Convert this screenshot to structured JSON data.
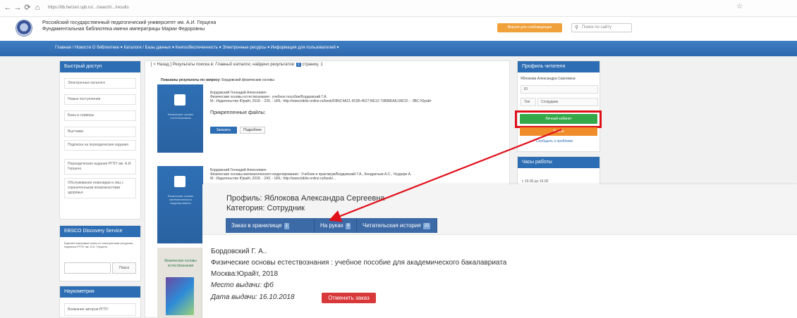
{
  "browser": {
    "url": "https://lib.herzen.spb.ru/.../search/.../results",
    "back_icon": "←",
    "forward_icon": "→",
    "reload_icon": "⟳",
    "home_icon": "⌂",
    "star_icon": "☆"
  },
  "header": {
    "university_line1": "Российский государственный педагогический университет им. А.И. Герцена",
    "university_line2": "Фундаментальная библиотека имени императрицы Марии Федоровны",
    "orange_button": "Версия для слабовидящих",
    "search_placeholder": "Поиск по сайту"
  },
  "nav": {
    "text": "Главная / Новости   О библиотеке ▾   Каталоги / Базы данных ▾   Книгообеспеченность ▾   Электронные ресурсы ▾   Информация для пользователей ▾"
  },
  "quick_access": {
    "title": "Быстрый доступ",
    "items": [
      "Электронные каталоги",
      "Новые поступления",
      "Базы и серверы",
      "Выставки",
      "Подписка на периодические издания",
      "Периодические издания РГПУ им. А.И. Герцена",
      "Обслуживание инвалидов и лиц с ограниченными возможностями здоровья"
    ]
  },
  "ebsco": {
    "title": "EBSCO Discovery Service",
    "text": "Единый поисковый поиск по электронным ресурсам, подписка РГПУ им. А.И. Герцена",
    "button": "Поиск"
  },
  "naukometria": {
    "title": "Наукометрия",
    "item": "Внимание авторов РГПУ"
  },
  "results": {
    "crumbs_prefix": "[ < Назад ] Результаты поиска в:",
    "crumbs_catalog": "Главный каталог",
    "crumbs_found": ", найдено результатов:",
    "crumbs_count": "2",
    "crumbs_pages": "страниц: 1",
    "shown_label": "Показаны результаты по запросу:",
    "shown_query": "Бордовский физические основы",
    "cover1_text": "Физические основы естествознания",
    "cover2_text": "Физические основы математического моделирования",
    "cover3_text": "Физические основы естествознания",
    "item1": {
      "author": "Бордовский Геннадий Алексеевич",
      "title": "Физические основы естествознания : учебное пособие/Бордовский Г.А.",
      "pub": "М.: Издательство Юрайт, 2018. - 226. - URL: http://www.biblio-online.ru/book/DB6C4A21-9C86-4627-BE12-73898EAE196CD. - ЭБС Юрайт",
      "files_label": "Прикрепленные файлы:",
      "order_button": "Заказать",
      "details_button": "Подробнее"
    },
    "item2": {
      "author": "Бордовский Геннадий Алексеевич",
      "title": "Физические основы математического моделирования : Учебник и практикум/Бордовский Г.А., Кондратьев А.С., Чоудери А.",
      "pub": "М.: Издательство Юрайт, 2018. - 243. - URL: http://www.biblio-online.ru/book/..."
    }
  },
  "profile": {
    "title": "Профиль читателя",
    "name": "Яблокова Александра Сергеевна",
    "id_label": "ID",
    "type_label": "Тип",
    "type_value": "Сотрудник",
    "cabinet_button": "Личный кабинет",
    "exit_button": "Выйти",
    "problem_link": "Сообщить о проблеме"
  },
  "hours": {
    "title": "Часы работы",
    "text": "с 10.00 до 19.00"
  },
  "zoom": {
    "profile_line": "Профиль: Яблокова Александра Сергеевна",
    "category_line": "Категория: Сотрудник",
    "tabs": [
      {
        "label": "Заказ в хранилище",
        "count": "1"
      },
      {
        "label": "На руках",
        "count": "4"
      },
      {
        "label": "Читательская история",
        "count": "22"
      }
    ],
    "author": "Бордовский Г. А..",
    "title": "Физические основы естествознания : учебное пособие для академического бакалавриата",
    "publisher": "Москва:Юрайт, 2018",
    "place_label": "Место выдачи: фб",
    "date_label": "Дата выдачи: 16.10.2018",
    "cancel_button": "Отменить заказ"
  },
  "colors": {
    "nav_blue": "#2d6db3",
    "highlight_red": "#e0101a",
    "cabinet_green": "#35a94a",
    "cancel_red": "#d9383a"
  }
}
